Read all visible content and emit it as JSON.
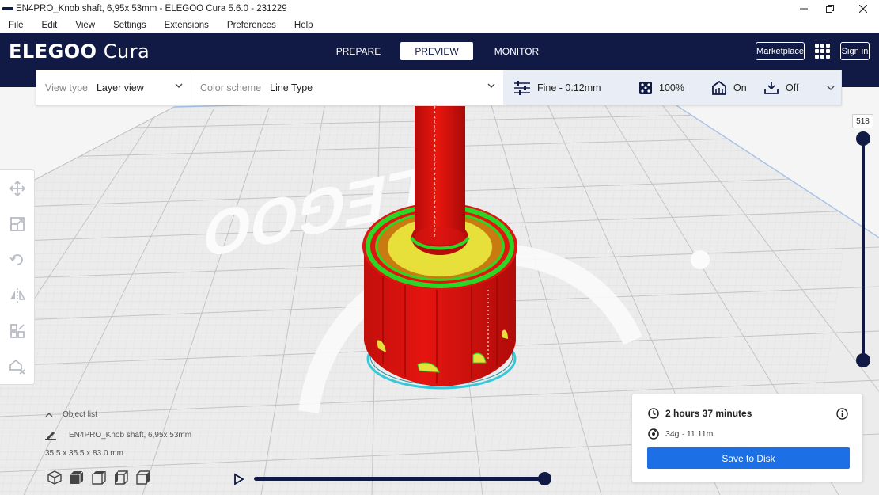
{
  "window": {
    "title": "EN4PRO_Knob  shaft, 6,95x 53mm - ELEGOO Cura 5.6.0 - 231229"
  },
  "menu": [
    "File",
    "Edit",
    "View",
    "Settings",
    "Extensions",
    "Preferences",
    "Help"
  ],
  "header": {
    "logo_main": "ELEGOO",
    "logo_sub": " Cura",
    "stages": [
      "PREPARE",
      "PREVIEW",
      "MONITOR"
    ],
    "active_stage": "PREVIEW",
    "marketplace": "Marketplace",
    "sign_in": "Sign in"
  },
  "settings_bar": {
    "view_type_label": "View type",
    "view_type_value": "Layer view",
    "color_scheme_label": "Color scheme",
    "color_scheme_value": "Line Type",
    "profile": "Fine - 0.12mm",
    "infill": "100%",
    "support": "On",
    "adhesion": "Off"
  },
  "viewport": {
    "bed_logo_text": "ELEGOO",
    "colors": {
      "wall": "#e01410",
      "inner_wall": "#2bd627",
      "top_bottom": "#e8e03a",
      "skirt": "#36c8d8"
    }
  },
  "layer_slider": {
    "current_layer": "518",
    "level": 1.0
  },
  "object_list": {
    "header": "Object list",
    "object_name": "EN4PRO_Knob  shaft, 6,95x 53mm",
    "dimensions": "35.5 x 35.5 x 83.0 mm"
  },
  "simulation": {
    "progress": 1.0
  },
  "print_info": {
    "time": "2 hours 37 minutes",
    "material": "34g · 11.11m",
    "save_button": "Save to Disk"
  }
}
